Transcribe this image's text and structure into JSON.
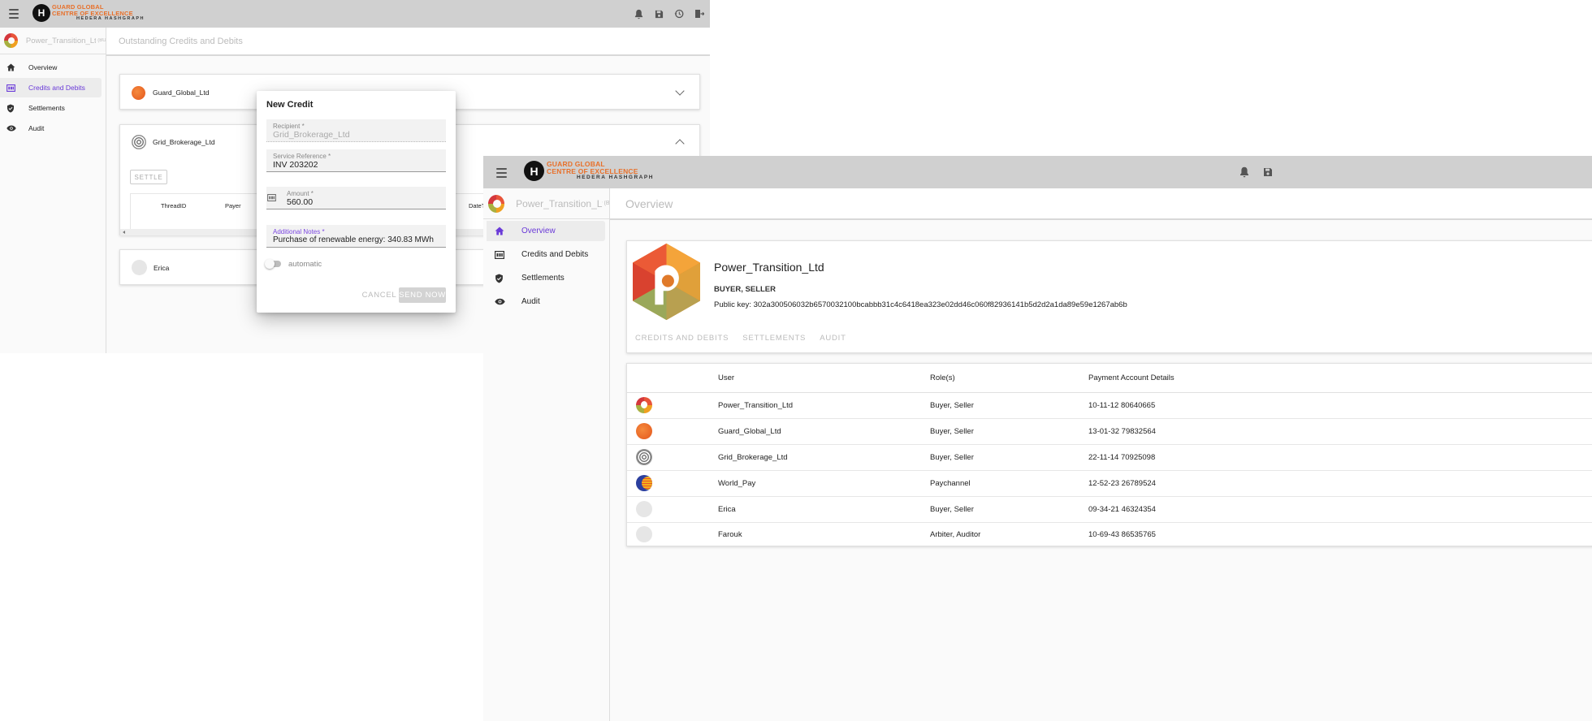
{
  "logo": {
    "letter": "H",
    "line1a": "GUARD GLOBAL",
    "line1b": "CENTRE OF EXCELLENCE",
    "line2": "HEDERA HASHGRAPH"
  },
  "win1": {
    "account_name": "Power_Transition_Ltd",
    "account_suffix": "(BU",
    "page_title": "Outstanding Credits and Debits",
    "nav": [
      {
        "label": "Overview",
        "icon": "home-icon"
      },
      {
        "label": "Credits and Debits",
        "icon": "credits-icon"
      },
      {
        "label": "Settlements",
        "icon": "shield-icon"
      },
      {
        "label": "Audit",
        "icon": "eye-icon"
      }
    ],
    "cards": [
      {
        "name": "Guard_Global_Ltd"
      },
      {
        "name": "Grid_Brokerage_Ltd"
      },
      {
        "name": "Erica"
      }
    ],
    "settle_label": "SETTLE",
    "thread_headers": [
      "ThreadID",
      "Payer",
      "DateT"
    ]
  },
  "dialog": {
    "title": "New Credit",
    "recipient_label": "Recipient *",
    "recipient_value": "Grid_Brokerage_Ltd",
    "service_label": "Service Reference *",
    "service_value": "INV 203202",
    "amount_label": "Amount *",
    "amount_value": "560.00",
    "notes_label": "Additional Notes *",
    "notes_value": "Purchase of renewable energy: 340.83 MWh",
    "toggle_label": "automatic",
    "cancel_label": "CANCEL",
    "send_label": "SEND NOW"
  },
  "win2": {
    "account_name": "Power_Transition_Ltd",
    "account_suffix": "(B",
    "page_title": "Overview",
    "nav": [
      {
        "label": "Overview",
        "icon": "home-icon"
      },
      {
        "label": "Credits and Debits",
        "icon": "credits-icon"
      },
      {
        "label": "Settlements",
        "icon": "shield-icon"
      },
      {
        "label": "Audit",
        "icon": "eye-icon"
      }
    ],
    "profile": {
      "name": "Power_Transition_Ltd",
      "roles": "BUYER, SELLER",
      "public_key": "Public key: 302a300506032b6570032100bcabbb31c4c6418ea323e02dd46c060f82936141b5d2d2a1da89e59e1267ab6b"
    },
    "profile_tabs": [
      "CREDITS AND DEBITS",
      "SETTLEMENTS",
      "AUDIT"
    ],
    "table": {
      "headers": [
        "User",
        "Role(s)",
        "Payment Account Details"
      ],
      "rows": [
        {
          "user": "Power_Transition_Ltd",
          "roles": "Buyer, Seller",
          "account": "10-11-12 80640665",
          "avatar": "power-transition-logo"
        },
        {
          "user": "Guard_Global_Ltd",
          "roles": "Buyer, Seller",
          "account": "13-01-32 79832564",
          "avatar": "guard-global-logo"
        },
        {
          "user": "Grid_Brokerage_Ltd",
          "roles": "Buyer, Seller",
          "account": "22-11-14 70925098",
          "avatar": "grid-brokerage-logo"
        },
        {
          "user": "World_Pay",
          "roles": "Paychannel",
          "account": "12-52-23 26789524",
          "avatar": "world-pay-logo"
        },
        {
          "user": "Erica",
          "roles": "Buyer, Seller",
          "account": "09-34-21 46324354",
          "avatar": "placeholder-avatar"
        },
        {
          "user": "Farouk",
          "roles": "Arbiter, Auditor",
          "account": "10-69-43 86535765",
          "avatar": "placeholder-avatar"
        }
      ]
    }
  }
}
